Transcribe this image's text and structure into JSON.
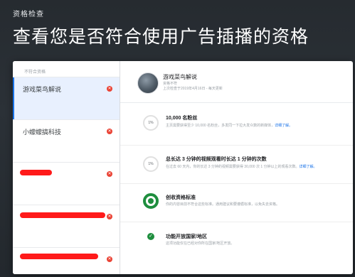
{
  "header": {
    "label": "资格检查",
    "headline": "查看您是否符合使用广告插播的资格"
  },
  "sidebar": {
    "header": "不符合资格",
    "channels": [
      {
        "name": "游戏菜鸟解说",
        "selected": true
      },
      {
        "name": "小蠓蠓搞科技",
        "selected": false
      }
    ],
    "fail_icon": "✕"
  },
  "channel": {
    "title": "游戏菜鸟解说",
    "status": "资格不符",
    "updated": "上次检查于2019年4月16日 - 每天更新"
  },
  "requirements": [
    {
      "ring_label": "1%",
      "title": "10,000 名粉丝",
      "desc": "主页需要获得至少 10,000 名粉丝，多发同一下拉大发众数的新媒体，",
      "link": "详细了解。"
    },
    {
      "ring_label": "1%",
      "title": "总长达 3 分钟的视频观看时长达 1 分钟的次数",
      "desc": "在过去 60 天内，你的长达 3 分钟的视频需要获得 30,000 次 1 分钟以上的观看次数。",
      "link": "详细了解。"
    },
    {
      "title": "创收资格标准",
      "desc": "你的内容目前不符合这些标准。通用建议和要遵循标准，以免失去资格。"
    },
    {
      "check_icon": "✓",
      "title": "功能开放国家/地区",
      "desc": "这项功能仅在已经对你所在国家/地区开放。"
    }
  ]
}
